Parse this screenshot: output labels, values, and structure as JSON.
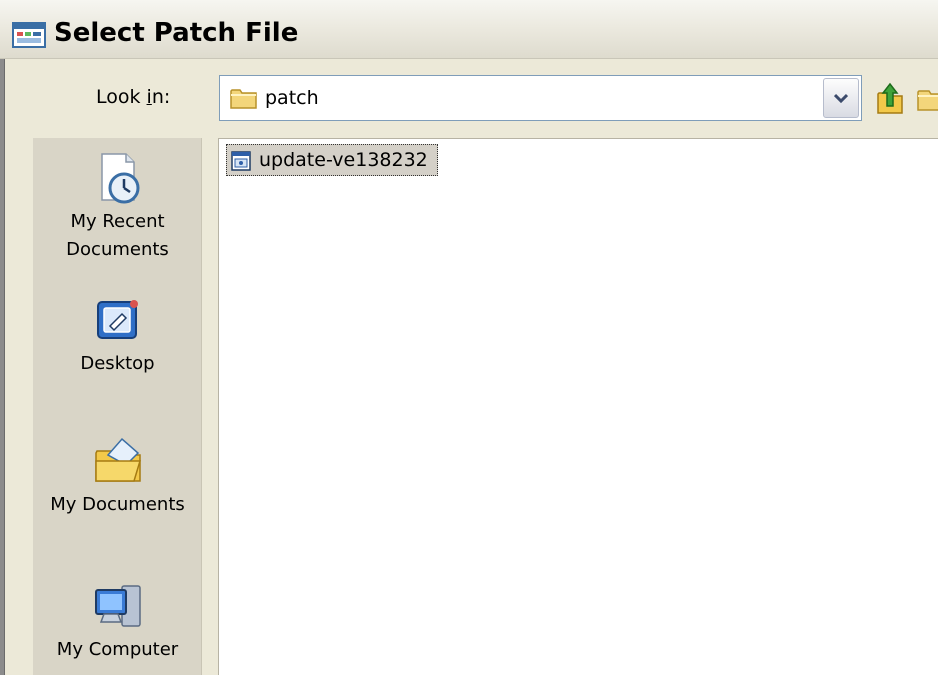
{
  "window": {
    "title": "Select Patch File"
  },
  "toolbar": {
    "lookin_label_pre": "Look ",
    "lookin_label_underlined": "i",
    "lookin_label_post": "n:",
    "current_folder": "patch",
    "up_icon": "up-one-level-icon",
    "new_folder_icon": "new-folder-icon"
  },
  "places": [
    {
      "label_line1": "My Recent",
      "label_line2": "Documents",
      "icon": "recent-documents-icon"
    },
    {
      "label_line1": "Desktop",
      "label_line2": "",
      "icon": "desktop-icon"
    },
    {
      "label_line1": "My Documents",
      "label_line2": "",
      "icon": "my-documents-icon"
    },
    {
      "label_line1": "My Computer",
      "label_line2": "",
      "icon": "my-computer-icon"
    }
  ],
  "files": [
    {
      "name": "update-ve138232",
      "icon": "executable-file-icon",
      "selected": true
    }
  ],
  "colors": {
    "dialog_bg": "#ece9d8",
    "places_bg": "#d9d5c7",
    "combo_border": "#7f9db9",
    "selection_bg": "#d4d0c8"
  }
}
